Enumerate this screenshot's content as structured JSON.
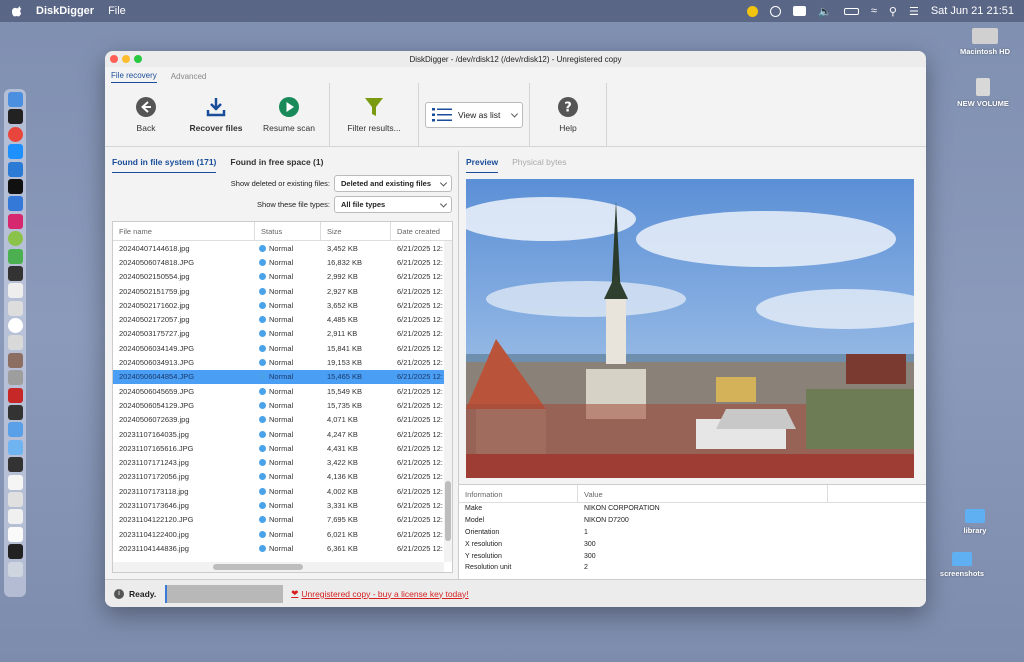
{
  "menubar": {
    "app_name": "DiskDigger",
    "menu_file": "File",
    "clock": "Sat Jun 21  21:51"
  },
  "desktop": {
    "icons": [
      {
        "label": "Macintosh HD"
      },
      {
        "label": "NEW VOLUME"
      },
      {
        "label": "library"
      },
      {
        "label": "screenshots"
      }
    ]
  },
  "window": {
    "title": "DiskDigger - /dev/rdisk12 (/dev/rdisk12) - Unregistered copy",
    "top_tabs": [
      "File recovery",
      "Advanced"
    ],
    "toolbar": {
      "back": "Back",
      "recover": "Recover files",
      "resume": "Resume scan",
      "filter": "Filter results...",
      "view": "View as list",
      "help": "Help"
    },
    "left": {
      "tab_fs": "Found in file system (171)",
      "tab_free": "Found in free space (1)",
      "filter1_label": "Show deleted or existing files:",
      "filter1_value": "Deleted and existing files",
      "filter2_label": "Show these file types:",
      "filter2_value": "All file types",
      "columns": [
        "File name",
        "Status",
        "Size",
        "Date created"
      ],
      "rows": [
        {
          "name": "20240407144618.jpg",
          "status": "Normal",
          "size": "3,452 KB",
          "date": "6/21/2025 12:"
        },
        {
          "name": "20240506074818.JPG",
          "status": "Normal",
          "size": "16,832 KB",
          "date": "6/21/2025 12:"
        },
        {
          "name": "20240502150554.jpg",
          "status": "Normal",
          "size": "2,992 KB",
          "date": "6/21/2025 12:"
        },
        {
          "name": "20240502151759.jpg",
          "status": "Normal",
          "size": "2,927 KB",
          "date": "6/21/2025 12:"
        },
        {
          "name": "20240502171602.jpg",
          "status": "Normal",
          "size": "3,652 KB",
          "date": "6/21/2025 12:"
        },
        {
          "name": "20240502172057.jpg",
          "status": "Normal",
          "size": "4,485 KB",
          "date": "6/21/2025 12:"
        },
        {
          "name": "20240503175727.jpg",
          "status": "Normal",
          "size": "2,911 KB",
          "date": "6/21/2025 12:"
        },
        {
          "name": "20240506034149.JPG",
          "status": "Normal",
          "size": "15,841 KB",
          "date": "6/21/2025 12:"
        },
        {
          "name": "20240506034913.JPG",
          "status": "Normal",
          "size": "19,153 KB",
          "date": "6/21/2025 12:"
        },
        {
          "name": "20240506044854.JPG",
          "status": "Normal",
          "size": "15,465 KB",
          "date": "6/21/2025 12:"
        },
        {
          "name": "20240506045659.JPG",
          "status": "Normal",
          "size": "15,549 KB",
          "date": "6/21/2025 12:"
        },
        {
          "name": "20240506054129.JPG",
          "status": "Normal",
          "size": "15,735 KB",
          "date": "6/21/2025 12:"
        },
        {
          "name": "20240506072639.jpg",
          "status": "Normal",
          "size": "4,071 KB",
          "date": "6/21/2025 12:"
        },
        {
          "name": "20231107164035.jpg",
          "status": "Normal",
          "size": "4,247 KB",
          "date": "6/21/2025 12:"
        },
        {
          "name": "20231107165616.JPG",
          "status": "Normal",
          "size": "4,431 KB",
          "date": "6/21/2025 12:"
        },
        {
          "name": "20231107171243.jpg",
          "status": "Normal",
          "size": "3,422 KB",
          "date": "6/21/2025 12:"
        },
        {
          "name": "20231107172056.jpg",
          "status": "Normal",
          "size": "4,136 KB",
          "date": "6/21/2025 12:"
        },
        {
          "name": "20231107173118.jpg",
          "status": "Normal",
          "size": "4,002 KB",
          "date": "6/21/2025 12:"
        },
        {
          "name": "20231107173646.jpg",
          "status": "Normal",
          "size": "3,331 KB",
          "date": "6/21/2025 12:"
        },
        {
          "name": "20231104122120.JPG",
          "status": "Normal",
          "size": "7,695 KB",
          "date": "6/21/2025 12:"
        },
        {
          "name": "20231104122400.jpg",
          "status": "Normal",
          "size": "6,021 KB",
          "date": "6/21/2025 12:"
        },
        {
          "name": "20231104144836.jpg",
          "status": "Normal",
          "size": "6,361 KB",
          "date": "6/21/2025 12:"
        }
      ],
      "selected_index": 9
    },
    "right": {
      "tab_preview": "Preview",
      "tab_bytes": "Physical bytes",
      "info_columns": [
        "Information",
        "Value"
      ],
      "info_rows": [
        {
          "k": "Make",
          "v": "NIKON CORPORATION"
        },
        {
          "k": "Model",
          "v": "NIKON D7200"
        },
        {
          "k": "Orientation",
          "v": "1"
        },
        {
          "k": "X resolution",
          "v": "300"
        },
        {
          "k": "Y resolution",
          "v": "300"
        },
        {
          "k": "Resolution unit",
          "v": "2"
        }
      ]
    },
    "status": {
      "text": "Ready.",
      "unregistered": "Unregistered copy - buy a license key today!"
    }
  },
  "colors": {
    "accent": "#1a4d99",
    "selection": "#4a9ef4",
    "link_red": "#d62020"
  }
}
